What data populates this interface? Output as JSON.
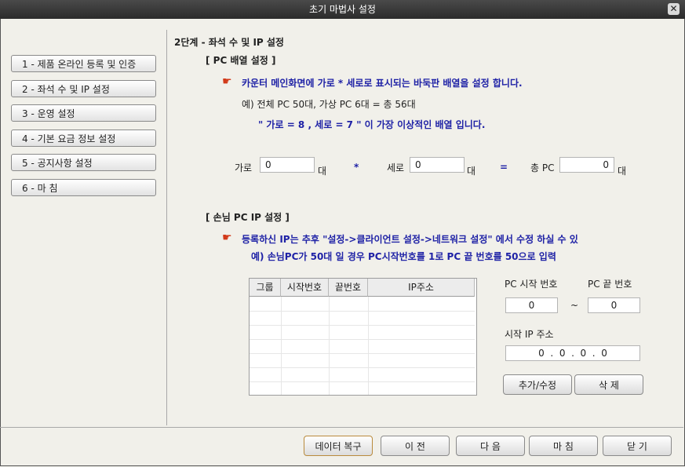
{
  "window": {
    "title": "초기 마법사 설정",
    "close_label": "✕"
  },
  "sidebar": {
    "items": [
      {
        "label": "1 - 제품 온라인 등록 및 인증"
      },
      {
        "label": "2 - 좌석 수 및 IP 설정"
      },
      {
        "label": "3 - 운영 설정"
      },
      {
        "label": "4 - 기본 요금 정보 설정"
      },
      {
        "label": "5 - 공지사항 설정"
      },
      {
        "label": "6 - 마 침"
      }
    ]
  },
  "main": {
    "step_title": "2단계 - 좌석 수 및 IP 설정",
    "pc_layout": {
      "section_title": "[ PC 배열 설정 ]",
      "hint_icon": "hand-pointer-icon",
      "hint": "카운터 메인화면에 가로 * 세로로 표시되는 바둑판 배열을 설정 합니다.",
      "example": "예) 전체 PC 50대, 가상 PC 6대 = 총 56대",
      "example_ideal": "\" 가로 = 8 , 세로 = 7 \"  이 가장 이상적인 배열 입니다.",
      "width_label": "가로",
      "width_value": "0",
      "width_unit": "대",
      "multiply": "*",
      "height_label": "세로",
      "height_value": "0",
      "height_unit": "대",
      "equals": "=",
      "total_label": "총 PC",
      "total_value": "0",
      "total_unit": "대"
    },
    "guest_ip": {
      "section_title": "[ 손님 PC IP 설정 ]",
      "hint_icon": "hand-pointer-icon",
      "hint": "등록하신 IP는 추후  \"설정->클라이언트 설정->네트워크 설정\" 에서 수정 하실 수 있",
      "example": "예) 손님PC가 50대 일 경우 PC시작번호를 1로 PC 끝 번호를 50으로 입력",
      "table": {
        "columns": [
          "그룹",
          "시작번호",
          "끝번호",
          "IP주소"
        ],
        "rows": []
      },
      "pc_start_label": "PC 시작 번호",
      "pc_end_label": "PC 끝 번호",
      "pc_start_value": "0",
      "tilde": "~",
      "pc_end_value": "0",
      "start_ip_label": "시작 IP 주소",
      "ip_value": "0  .  0  .  0  .  0",
      "add_edit_button": "추가/수정",
      "delete_button": "삭 제"
    }
  },
  "footer": {
    "restore_button": "데이터 복구",
    "prev_button": "이 전",
    "next_button": "다 음",
    "finish_button": "마 침",
    "close_button": "닫 기"
  }
}
